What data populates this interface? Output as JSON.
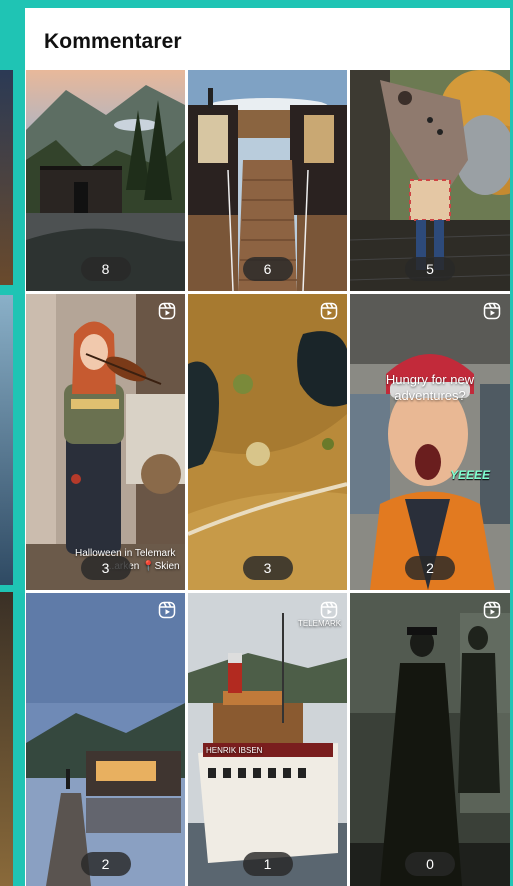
{
  "header": {
    "title": "Kommentarer"
  },
  "tiles": [
    {
      "count": "8",
      "reel": false,
      "alt": "cabin-in-mountains"
    },
    {
      "count": "6",
      "reel": false,
      "alt": "dock-walkway"
    },
    {
      "count": "5",
      "reel": false,
      "alt": "dragon-head-sculpture"
    },
    {
      "count": "3",
      "reel": true,
      "alt": "violinist",
      "caption_1": "Halloween in Telemark",
      "caption_2": "...arken 📍Skien"
    },
    {
      "count": "3",
      "reel": true,
      "alt": "aerial-bog"
    },
    {
      "count": "2",
      "reel": true,
      "alt": "skier-shouting",
      "overlay_1": "Hungry for new",
      "overlay_2": "adventures?",
      "shout": "YEEEE"
    },
    {
      "count": "2",
      "reel": true,
      "alt": "lake-cabin"
    },
    {
      "count": "1",
      "reel": true,
      "alt": "steamboat",
      "watermark": "TELEMARK",
      "ship_name": "HENRIK IBSEN"
    },
    {
      "count": "0",
      "reel": true,
      "alt": "dark-figures"
    }
  ],
  "colors": {
    "accent": "#1fc4b4",
    "badge": "#2a2a2a"
  },
  "icons": {
    "reel": "reel-icon"
  }
}
